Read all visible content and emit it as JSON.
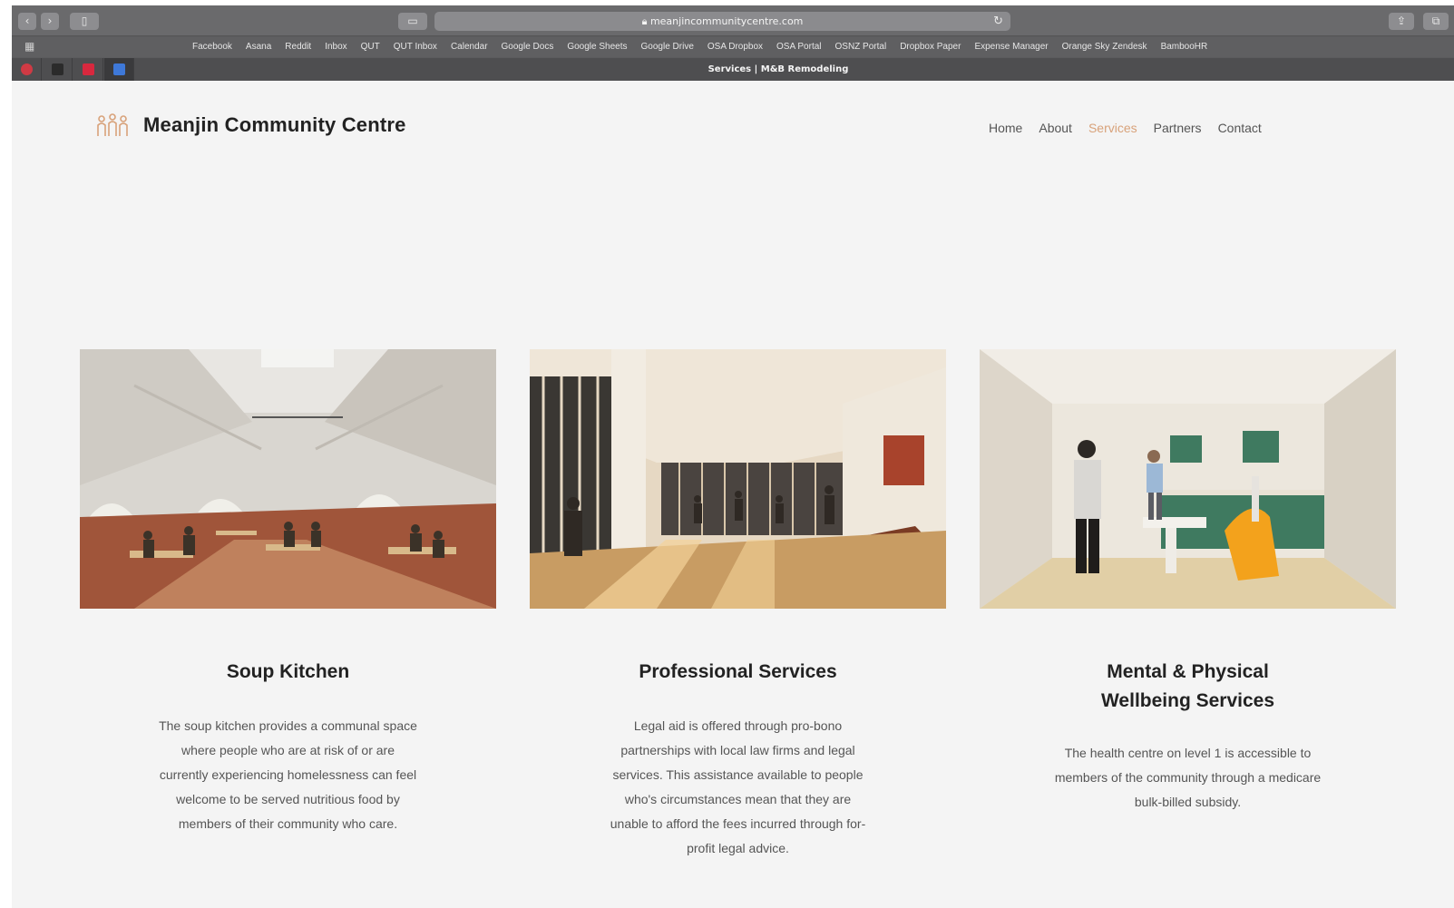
{
  "browser": {
    "url": "meanjincommunitycentre.com",
    "tab_title": "Services | M&B Remodeling",
    "bookmarks": [
      "Facebook",
      "Asana",
      "Reddit",
      "Inbox",
      "QUT",
      "QUT Inbox",
      "Calendar",
      "Google Docs",
      "Google Sheets",
      "Google Drive",
      "OSA Dropbox",
      "OSA Portal",
      "OSNZ Portal",
      "Dropbox Paper",
      "Expense Manager",
      "Orange Sky Zendesk",
      "BambooHR"
    ],
    "icons": {
      "back": "chevron-left-icon",
      "forward": "chevron-right-icon",
      "sidebar": "sidebar-icon",
      "tabs": "tab-overview-icon",
      "lock": "lock-icon",
      "reload": "reload-icon",
      "share": "share-icon",
      "new_tab": "new-tab-icon",
      "favorites_grid": "grid-icon"
    }
  },
  "site": {
    "brand": "Meanjin Community Centre",
    "logo_icon": "people-icon",
    "accent_color": "#d8a27a",
    "nav": [
      {
        "label": "Home",
        "active": false
      },
      {
        "label": "About",
        "active": false
      },
      {
        "label": "Services",
        "active": true
      },
      {
        "label": "Partners",
        "active": false
      },
      {
        "label": "Contact",
        "active": false
      }
    ]
  },
  "services": [
    {
      "title": "Soup Kitchen",
      "text": "The soup kitchen provides a communal space where people who are at risk of or are  currently experiencing homelessness can feel welcome to be served nutritious food by members of their community who care."
    },
    {
      "title": "Professional Services",
      "text": "Legal aid is offered through pro-bono partnerships with local law firms and legal services. This assistance available to people who's circumstances mean that they are unable to afford the fees incurred through for-profit legal advice."
    },
    {
      "title": "Mental & Physical Wellbeing Services",
      "text": "The health centre on level 1 is accessible to members of the community through a medicare bulk-billed subsidy."
    }
  ]
}
